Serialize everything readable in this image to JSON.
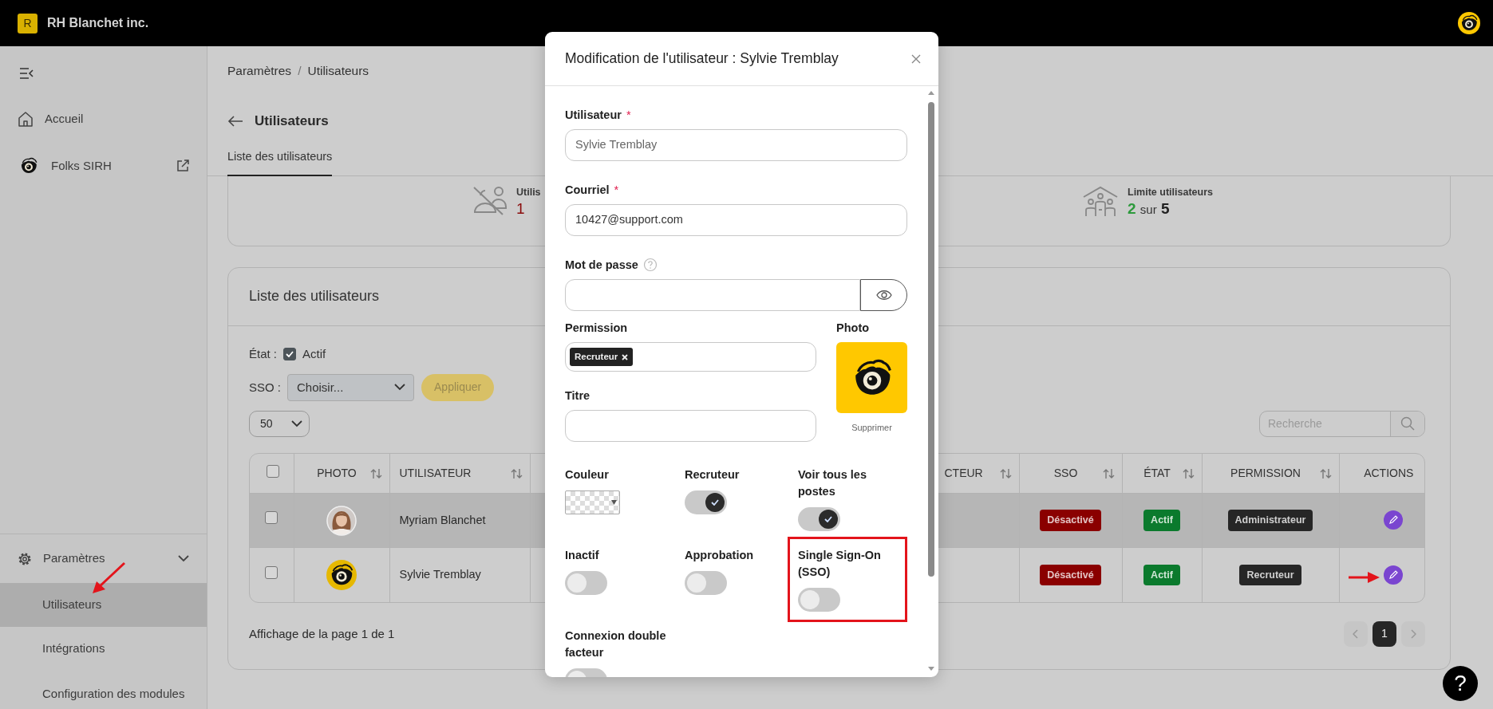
{
  "app_bar": {
    "initial": "R",
    "company": "RH Blanchet inc."
  },
  "sidebar": {
    "items": [
      {
        "kind": "home",
        "label": "Accueil",
        "external": false,
        "selected": false
      },
      {
        "kind": "brand",
        "label": "Folks SIRH",
        "external": true,
        "selected": false
      }
    ],
    "settings": {
      "label": "Paramètres",
      "expanded": true,
      "children": [
        {
          "label": "Utilisateurs",
          "selected": true,
          "pointer": true
        },
        {
          "label": "Intégrations",
          "selected": false,
          "pointer": false
        },
        {
          "label": "Configuration des modules",
          "selected": false,
          "pointer": false
        }
      ]
    }
  },
  "breadcrumb": {
    "items": [
      "Paramètres",
      "Utilisateurs"
    ],
    "separator": "/"
  },
  "page_title": "Utilisateurs",
  "tabs": [
    {
      "label": "Liste des utilisateurs",
      "selected": true
    }
  ],
  "stats": [
    {
      "kind": "inactive",
      "label": "Utilis",
      "value": "1"
    },
    {
      "kind": "limit",
      "label": "Limite utilisateurs",
      "value": "2",
      "separator": "sur",
      "total": "5"
    }
  ],
  "users_card": {
    "title": "Liste des utilisateurs",
    "filters": {
      "state_label": "État :",
      "active_label": "Actif",
      "active_checked": true,
      "sso_label": "SSO :",
      "sso_placeholder": "Choisir...",
      "apply": "Appliquer",
      "page_size": "50",
      "search_placeholder": "Recherche"
    },
    "table": {
      "columns": [
        {
          "kind": "checkbox",
          "checked": false
        },
        {
          "kind": "text",
          "label": "PHOTO"
        },
        {
          "kind": "text",
          "label": "UTILISATEUR"
        },
        {
          "kind": "text",
          "label": "CTEUR"
        },
        {
          "kind": "text",
          "label": "SSO"
        },
        {
          "kind": "text",
          "label": "ÉTAT"
        },
        {
          "kind": "text",
          "label": "PERMISSION"
        },
        {
          "kind": "text",
          "label": "ACTIONS"
        }
      ],
      "rows": [
        {
          "checked": false,
          "hovered": true,
          "name": "Myriam Blanchet",
          "sso": "Désactivé",
          "state": "Actif",
          "permission": "Administrateur",
          "pointer": false
        },
        {
          "checked": false,
          "hovered": false,
          "photo": {
            "kind": "logo"
          },
          "name": "Sylvie Tremblay",
          "sso": "Désactivé",
          "state": "Actif",
          "permission": "Recruteur",
          "pointer": true
        }
      ]
    },
    "pagination": {
      "summary": "Affichage de la page 1 de 1",
      "pages": [
        {
          "label": "1",
          "selected": true
        }
      ]
    }
  },
  "modal": {
    "title": "Modification de l'utilisateur : Sylvie Tremblay",
    "fields": [
      {
        "kind": "text",
        "label": "Utilisateur",
        "marker": "*",
        "value": "Sylvie Tremblay",
        "disabled": true
      },
      {
        "kind": "text",
        "label": "Courriel",
        "marker": "*",
        "value": "10427@support.com",
        "disabled": false
      },
      {
        "kind": "password",
        "label": "Mot de passe",
        "help": true
      }
    ],
    "permission": {
      "label": "Permission",
      "tags": [
        "Recruteur"
      ]
    },
    "title_field": {
      "label": "Titre"
    },
    "photo": {
      "label": "Photo",
      "remove": "Supprimer"
    },
    "options": [
      {
        "kind": "color",
        "label": "Couleur"
      },
      {
        "kind": "toggle",
        "label": "Recruteur",
        "on": true,
        "highlighted": false
      },
      {
        "kind": "toggle",
        "label": "Voir tous les postes",
        "on": true,
        "highlighted": false
      },
      {
        "kind": "toggle",
        "label": "Inactif",
        "on": false,
        "highlighted": false
      },
      {
        "kind": "toggle",
        "label": "Approbation",
        "on": false,
        "highlighted": false
      },
      {
        "kind": "toggle",
        "label": "Single Sign-On (SSO)",
        "on": false,
        "highlighted": true
      },
      {
        "kind": "toggle",
        "label": "Connexion double facteur",
        "on": false,
        "highlighted": false
      }
    ]
  },
  "help_button": "?"
}
